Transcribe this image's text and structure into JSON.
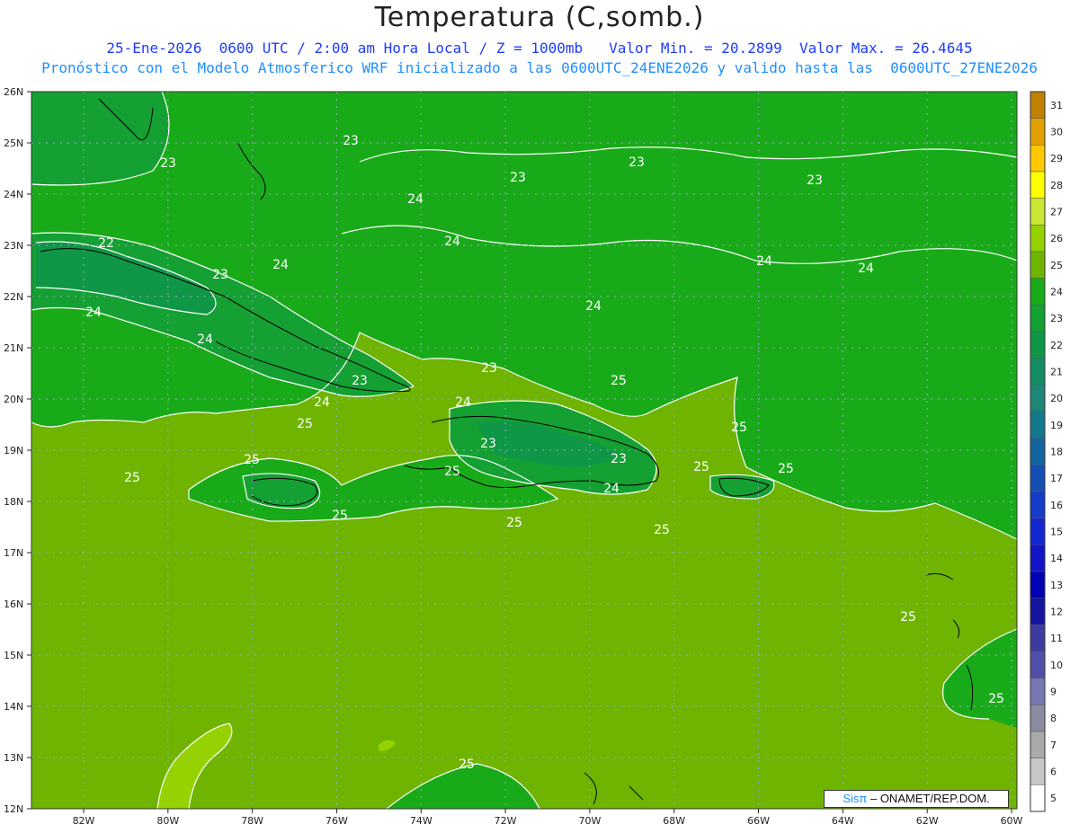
{
  "title": "Temperatura (C,somb.)",
  "subtitle_1": "25-Ene-2026  0600 UTC / 2:00 am Hora Local / Z = 1000mb   Valor Min. = 20.2899  Valor Max. = 26.4645",
  "subtitle_2": "Pronóstico con el Modelo Atmosferico WRF inicializado a las 0600UTC_24ENE2026 y valido hasta las  0600UTC_27ENE2026",
  "credit_brand": "Sisπ",
  "credit_rest": " – ONAMET/REP.DOM.",
  "lat_labels": [
    "26N",
    "25N",
    "24N",
    "23N",
    "22N",
    "21N",
    "20N",
    "19N",
    "18N",
    "17N",
    "16N",
    "15N",
    "14N",
    "13N",
    "12N"
  ],
  "lon_labels": [
    "82W",
    "80W",
    "78W",
    "76W",
    "74W",
    "72W",
    "70W",
    "68W",
    "66W",
    "64W",
    "62W",
    "60W"
  ],
  "colorbar": {
    "levels": [
      "31",
      "30",
      "29",
      "28",
      "27",
      "26",
      "25",
      "24",
      "23",
      "22",
      "21",
      "20",
      "19",
      "18",
      "17",
      "16",
      "15",
      "14",
      "13",
      "12",
      "11",
      "10",
      "9",
      "8",
      "7",
      "6",
      "5"
    ],
    "colors": [
      "#c08000",
      "#e0a000",
      "#ffc800",
      "#ffff00",
      "#c8e632",
      "#96d200",
      "#6eb400",
      "#19aa19",
      "#14a032",
      "#0f9646",
      "#148c64",
      "#1e8778",
      "#14788c",
      "#1464a0",
      "#1450b4",
      "#143cc8",
      "#1428d2",
      "#1414c8",
      "#0000b4",
      "#1414a0",
      "#3c3ca0",
      "#5050aa",
      "#7878b4",
      "#8c8ca0",
      "#aaaaaa",
      "#c8c8c8",
      "#ffffff"
    ]
  },
  "contour_labels": [
    "23",
    "23",
    "23",
    "23",
    "23",
    "24",
    "24",
    "24",
    "24",
    "24",
    "24",
    "24",
    "22",
    "23",
    "24",
    "23",
    "23",
    "24",
    "25",
    "25",
    "24",
    "23",
    "23",
    "25",
    "25",
    "25",
    "25",
    "25",
    "25",
    "24",
    "25",
    "25",
    "25",
    "25",
    "25",
    "25"
  ],
  "colors": {
    "region_25": "#6eb400",
    "region_24": "#19aa19",
    "region_23": "#14a032",
    "region_22": "#0f9646",
    "region_26": "#96d200"
  }
}
